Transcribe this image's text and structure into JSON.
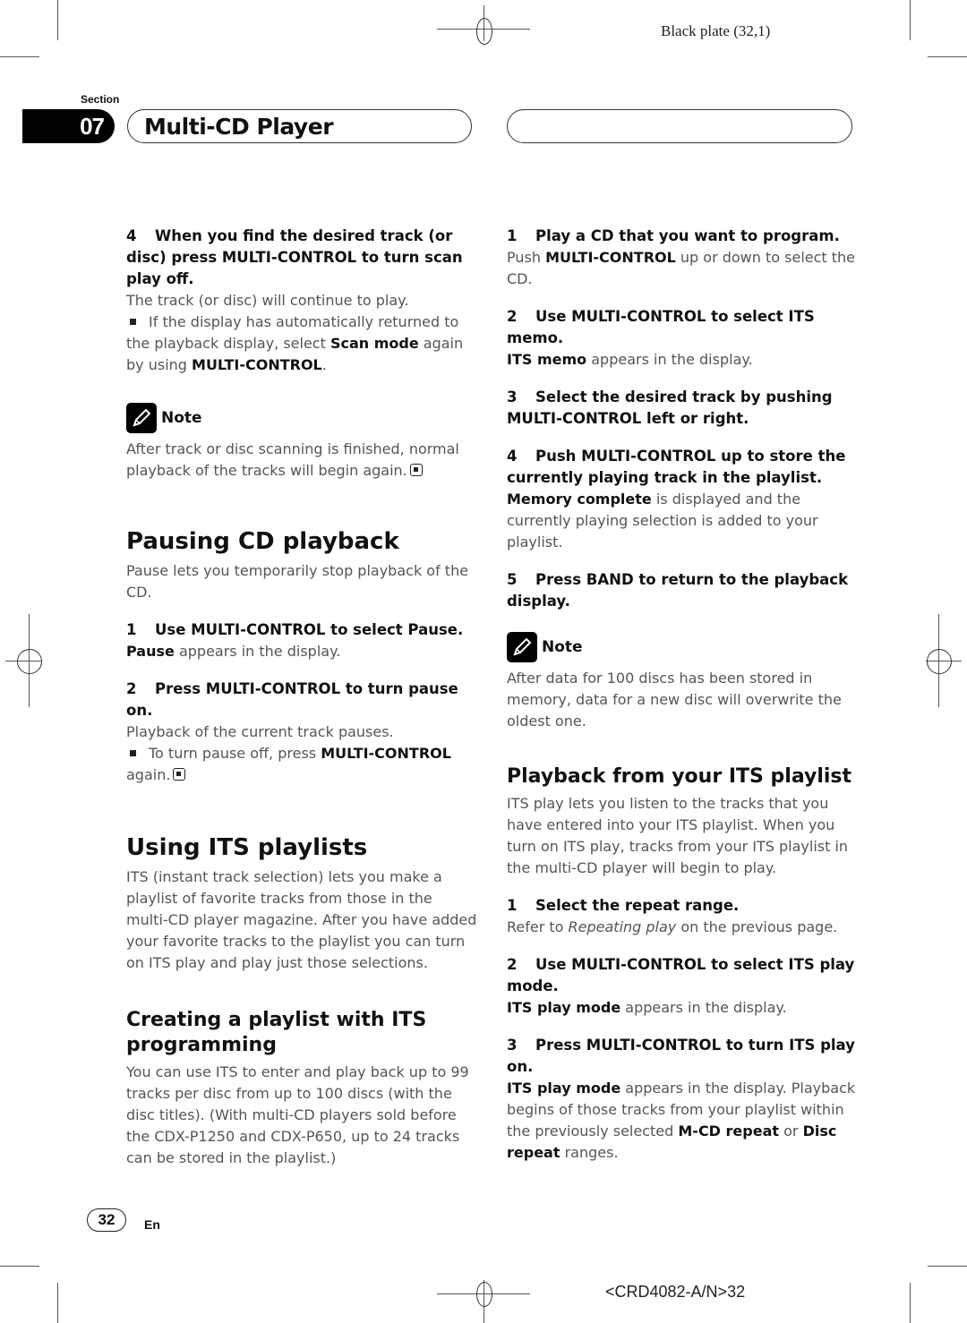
{
  "header": {
    "plate": "Black plate (32,1)",
    "section_label": "Section",
    "section_number": "07",
    "chapter_title": "Multi-CD Player"
  },
  "left_column": {
    "step4": {
      "number": "4",
      "title": "When you find the desired track (or disc) press MULTI-CONTROL to turn scan play off.",
      "body": "The track (or disc) will continue to play.",
      "bullet_pre": "If the display has automatically returned to the playback display, select ",
      "bullet_bold1": "Scan mode",
      "bullet_mid": " again by using ",
      "bullet_bold2": "MULTI-CONTROL",
      "bullet_post": "."
    },
    "note1": {
      "label": "Note",
      "text": "After track or disc scanning is finished, normal playback of the tracks will begin again."
    },
    "pausing": {
      "heading": "Pausing CD playback",
      "intro": "Pause lets you temporarily stop playback of the CD.",
      "step1_number": "1",
      "step1_title": "Use MULTI-CONTROL to select Pause.",
      "step1_bold": "Pause",
      "step1_body": " appears in the display.",
      "step2_number": "2",
      "step2_title": "Press MULTI-CONTROL to turn pause on.",
      "step2_body": "Playback of the current track pauses.",
      "bullet_pre": "To turn pause off, press ",
      "bullet_bold": "MULTI-CONTROL",
      "bullet_post": " again."
    },
    "its": {
      "heading": "Using ITS playlists",
      "intro": "ITS (instant track selection) lets you make a playlist of favorite tracks from those in the multi-CD player magazine. After you have added your favorite tracks to the playlist you can turn on ITS play and play just those selections."
    },
    "creating": {
      "heading": "Creating a playlist with ITS programming",
      "intro": "You can use ITS to enter and play back up to 99 tracks per disc from up to 100 discs (with the disc titles). (With multi-CD players sold before the CDX-P1250 and CDX-P650, up to 24 tracks can be stored in the playlist.)"
    }
  },
  "right_column": {
    "prog_steps": [
      {
        "number": "1",
        "title": "Play a CD that you want to program.",
        "pre": "Push ",
        "bold": "MULTI-CONTROL",
        "post": " up or down to select the CD."
      },
      {
        "number": "2",
        "title": "Use MULTI-CONTROL to select ITS memo.",
        "pre": "",
        "bold": "ITS memo",
        "post": " appears in the display."
      },
      {
        "number": "3",
        "title": "Select the desired track by pushing MULTI-CONTROL left or right.",
        "pre": "",
        "bold": "",
        "post": ""
      },
      {
        "number": "4",
        "title": "Push MULTI-CONTROL up to store the currently playing track in the playlist.",
        "pre": "",
        "bold": "Memory complete",
        "post": " is displayed and the currently playing selection is added to your playlist."
      },
      {
        "number": "5",
        "title": "Press BAND to return to the playback display.",
        "pre": "",
        "bold": "",
        "post": ""
      }
    ],
    "note2": {
      "label": "Note",
      "text": "After data for 100 discs has been stored in memory, data for a new disc will overwrite the oldest one."
    },
    "playback": {
      "heading": "Playback from your ITS playlist",
      "intro": "ITS play lets you listen to the tracks that you have entered into your ITS playlist. When you turn on ITS play, tracks from your ITS playlist in the multi-CD player will begin to play.",
      "step1_number": "1",
      "step1_title": "Select the repeat range.",
      "step1_pre": "Refer to ",
      "step1_italic": "Repeating play",
      "step1_post": " on the previous page.",
      "step2_number": "2",
      "step2_title": "Use MULTI-CONTROL to select ITS play mode.",
      "step2_bold": "ITS play mode",
      "step2_post": " appears in the display.",
      "step3_number": "3",
      "step3_title": "Press MULTI-CONTROL to turn ITS play on.",
      "step3_bold1": "ITS play mode",
      "step3_mid1": " appears in the display. Playback begins of those tracks from your playlist within the previously selected ",
      "step3_bold2": "M-CD repeat",
      "step3_mid2": " or ",
      "step3_bold3": "Disc repeat",
      "step3_post": " ranges."
    }
  },
  "footer": {
    "page_number": "32",
    "language": "En",
    "doc_code": "<CRD4082-A/N>32"
  }
}
